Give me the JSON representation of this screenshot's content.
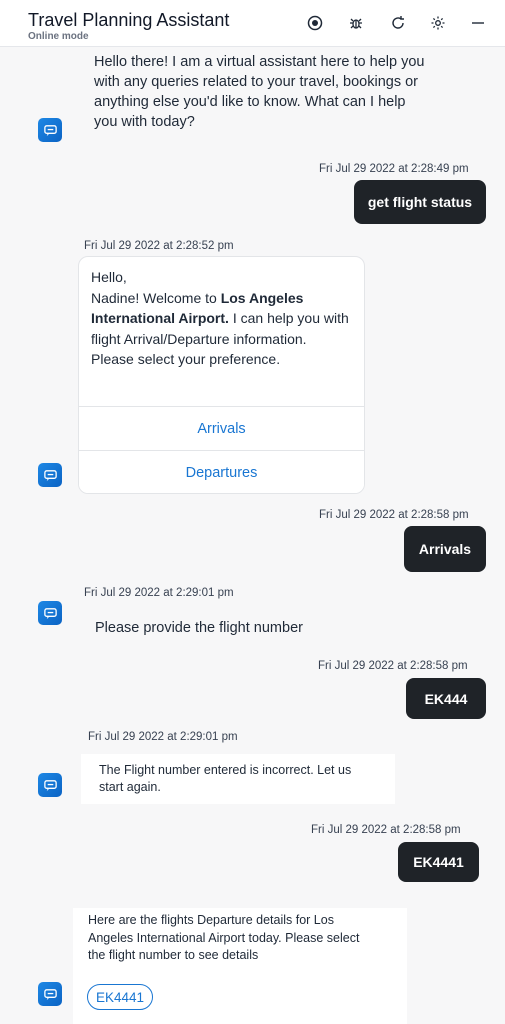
{
  "header": {
    "title": "Travel Planning Assistant",
    "subtitle": "Online mode",
    "icons": [
      "record-icon",
      "bug-icon",
      "refresh-icon",
      "settings-icon",
      "minimize-icon"
    ]
  },
  "messages": {
    "welcome": {
      "lines": [
        "Hello there! I am a virtual assistant here to help you",
        "with any queries related to your travel, bookings or",
        "anything else you'd like to know. What can I help",
        "you with today?"
      ]
    },
    "user1": {
      "timestamp": "Fri Jul 29 2022 at 2:28:49 pm",
      "text": "get flight status"
    },
    "bot2": {
      "timestamp": "Fri Jul 29 2022 at 2:28:52 pm",
      "greeting": "Hello,",
      "name_part": "Nadine! Welcome to ",
      "airport": "Los Angeles International Airport.",
      "rest": " I can help you with flight Arrival/Departure information. Please select your preference.",
      "buttons": [
        "Arrivals",
        "Departures"
      ]
    },
    "user2": {
      "timestamp": "Fri Jul 29 2022 at 2:28:58 pm",
      "text": "Arrivals"
    },
    "bot3": {
      "timestamp": "Fri Jul 29 2022 at 2:29:01 pm",
      "text": "Please provide the flight number"
    },
    "user3": {
      "timestamp": "Fri Jul 29 2022 at 2:28:58 pm",
      "text": "EK444"
    },
    "bot4": {
      "timestamp": "Fri Jul 29 2022 at 2:29:01 pm",
      "lines": [
        "The Flight number entered is incorrect. Let us",
        "start again."
      ]
    },
    "user4": {
      "timestamp": "Fri Jul 29 2022 at 2:28:58 pm",
      "text": "EK4441"
    },
    "bot5": {
      "lines": [
        "Here are the flights Departure details for Los",
        "Angeles International Airport today. Please select",
        "the flight number to see details"
      ],
      "chip": "EK4441"
    }
  }
}
